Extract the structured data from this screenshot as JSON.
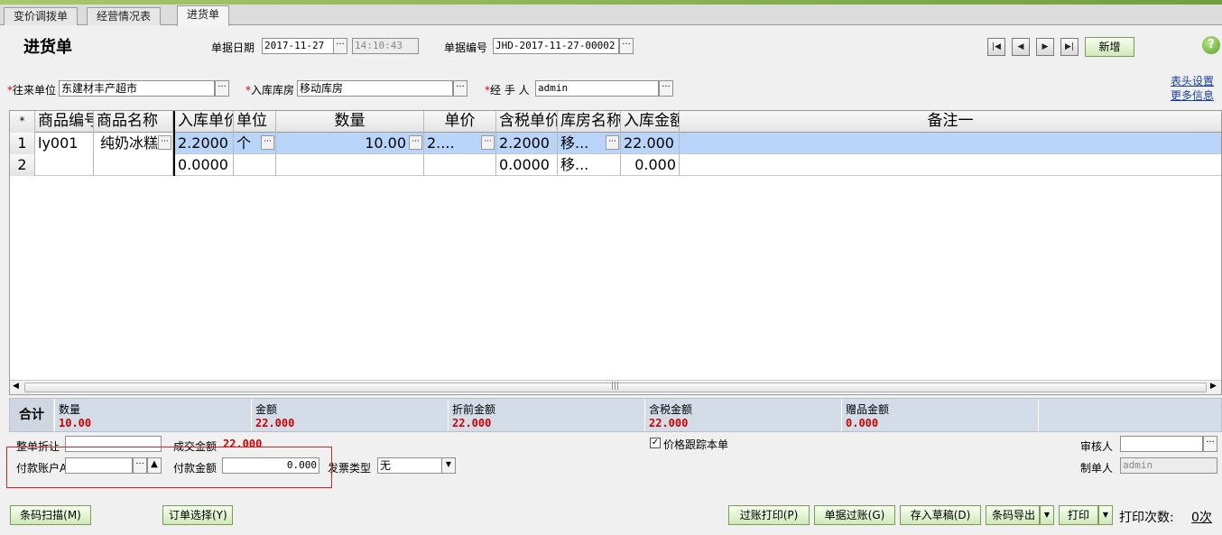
{
  "tabs": [
    "变价调拨单",
    "经营情况表",
    "进货单"
  ],
  "title": "进货单",
  "header": {
    "date_label": "单据日期",
    "date_value": "2017-11-27",
    "time_value": "14:10:43",
    "billno_label": "单据编号",
    "billno_value": "JHD-2017-11-27-00002",
    "new_label": "新增",
    "help": "?",
    "supplier_label": "往来单位",
    "supplier_value": "东建材丰产超市",
    "warehouse_label": "入库库房",
    "warehouse_value": "移动库房",
    "handler_label": "经 手 人",
    "handler_value": "admin",
    "link_header_settings": "表头设置",
    "link_more_info": "更多信息",
    "required_mark": "*",
    "ellipsis": "···"
  },
  "grid": {
    "columns": [
      "*",
      "商品编号",
      "商品名称",
      "入库单价",
      "单位",
      "数量",
      "单价",
      "含税单价",
      "库房名称",
      "入库金额",
      "备注一"
    ],
    "rows": [
      [
        "1",
        "ly001",
        "纯奶冰糕",
        "2.2000",
        "个",
        "10.00",
        "2....",
        "2.2000",
        "移...",
        "22.000",
        ""
      ],
      [
        "2",
        "",
        "",
        "0.0000",
        "",
        "",
        "",
        "0.0000",
        "移...",
        "0.000",
        ""
      ]
    ]
  },
  "summary": {
    "label": "合计",
    "cells": [
      {
        "k": "数量",
        "v": "10.00"
      },
      {
        "k": "金额",
        "v": "22.000"
      },
      {
        "k": "折前金额",
        "v": "22.000"
      },
      {
        "k": "含税金额",
        "v": "22.000"
      },
      {
        "k": "赠品金额",
        "v": "0.000"
      }
    ]
  },
  "footer": {
    "discount_label": "整单折让",
    "deal_label": "成交金额",
    "deal_value": "22.000",
    "price_track_label": "价格跟踪本单",
    "auditor_label": "审核人",
    "account_label": "付款账户A",
    "paid_label": "付款金额",
    "paid_value": "0.000",
    "invoice_label": "发票类型",
    "invoice_value": "无",
    "maker_label": "制单人",
    "maker_value": "admin"
  },
  "buttons": {
    "barcode_scan": "条码扫描(M)",
    "order_select": "订单选择(Y)",
    "post_print": "过账打印(P)",
    "post": "单据过账(G)",
    "draft": "存入草稿(D)",
    "barcode_export": "条码导出",
    "print": "打印",
    "print_count_label": "打印次数:",
    "print_count_value": "0次"
  }
}
